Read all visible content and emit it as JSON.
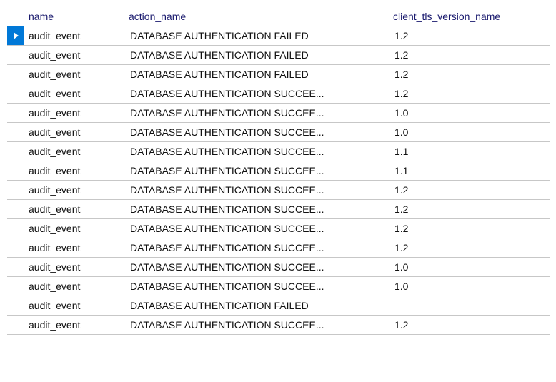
{
  "headers": {
    "indicator": "",
    "name": "name",
    "action_name": "action_name",
    "client_tls_version_name": "client_tls_version_name"
  },
  "rows": [
    {
      "name": "audit_event",
      "action_name": "DATABASE AUTHENTICATION FAILED",
      "client_tls_version_name": "1.2",
      "selected": true,
      "indicator": true
    },
    {
      "name": "audit_event",
      "action_name": "DATABASE AUTHENTICATION FAILED",
      "client_tls_version_name": "1.2"
    },
    {
      "name": "audit_event",
      "action_name": "DATABASE AUTHENTICATION FAILED",
      "client_tls_version_name": "1.2"
    },
    {
      "name": "audit_event",
      "action_name": "DATABASE AUTHENTICATION SUCCEE...",
      "client_tls_version_name": "1.2"
    },
    {
      "name": "audit_event",
      "action_name": "DATABASE AUTHENTICATION SUCCEE...",
      "client_tls_version_name": "1.0"
    },
    {
      "name": "audit_event",
      "action_name": "DATABASE AUTHENTICATION SUCCEE...",
      "client_tls_version_name": "1.0"
    },
    {
      "name": "audit_event",
      "action_name": "DATABASE AUTHENTICATION SUCCEE...",
      "client_tls_version_name": "1.1"
    },
    {
      "name": "audit_event",
      "action_name": "DATABASE AUTHENTICATION SUCCEE...",
      "client_tls_version_name": "1.1"
    },
    {
      "name": "audit_event",
      "action_name": "DATABASE AUTHENTICATION SUCCEE...",
      "client_tls_version_name": "1.2"
    },
    {
      "name": "audit_event",
      "action_name": "DATABASE AUTHENTICATION SUCCEE...",
      "client_tls_version_name": "1.2"
    },
    {
      "name": "audit_event",
      "action_name": "DATABASE AUTHENTICATION SUCCEE...",
      "client_tls_version_name": "1.2"
    },
    {
      "name": "audit_event",
      "action_name": "DATABASE AUTHENTICATION SUCCEE...",
      "client_tls_version_name": "1.2"
    },
    {
      "name": "audit_event",
      "action_name": "DATABASE AUTHENTICATION SUCCEE...",
      "client_tls_version_name": "1.0"
    },
    {
      "name": "audit_event",
      "action_name": "DATABASE AUTHENTICATION SUCCEE...",
      "client_tls_version_name": "1.0"
    },
    {
      "name": "audit_event",
      "action_name": "DATABASE AUTHENTICATION FAILED",
      "client_tls_version_name": ""
    },
    {
      "name": "audit_event",
      "action_name": "DATABASE AUTHENTICATION SUCCEE...",
      "client_tls_version_name": "1.2"
    }
  ]
}
